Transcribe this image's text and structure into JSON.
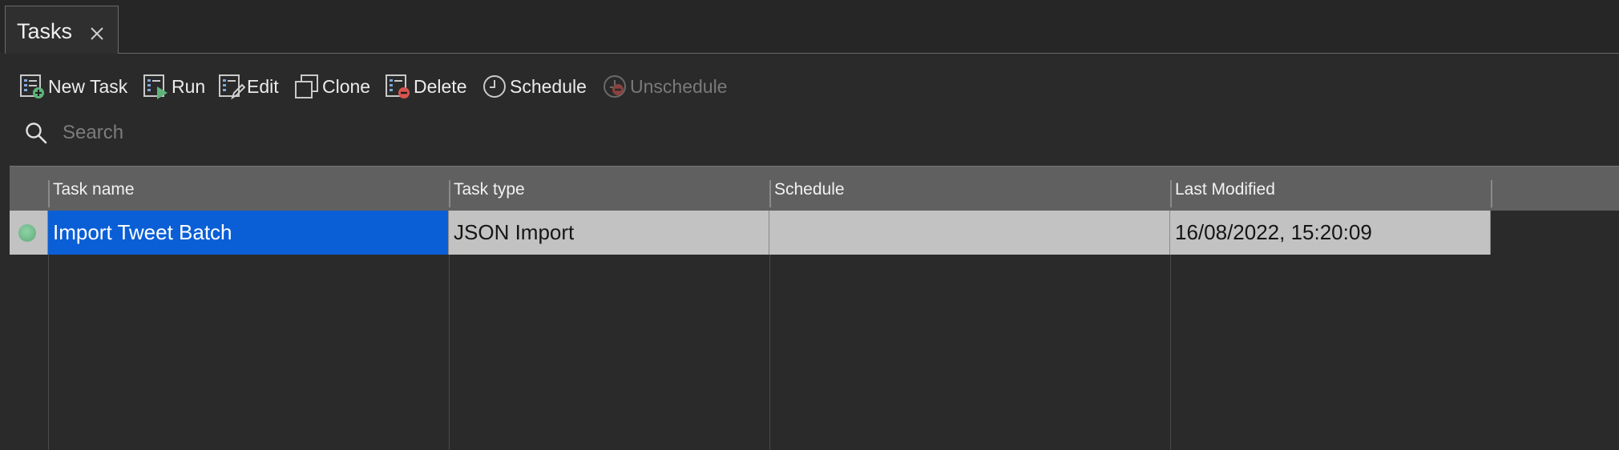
{
  "tab": {
    "title": "Tasks"
  },
  "toolbar": {
    "new_task": "New Task",
    "run": "Run",
    "edit": "Edit",
    "clone": "Clone",
    "delete": "Delete",
    "schedule": "Schedule",
    "unschedule": "Unschedule"
  },
  "search": {
    "placeholder": "Search",
    "value": ""
  },
  "table": {
    "columns": [
      "Task name",
      "Task type",
      "Schedule",
      "Last Modified"
    ],
    "rows": [
      {
        "status": "active",
        "task_name": "Import Tweet Batch",
        "task_type": "JSON Import",
        "schedule": "",
        "last_modified": "16/08/2022, 15:20:09"
      }
    ]
  },
  "colors": {
    "selection": "#0a5fd6",
    "status_active": "#6fbf8c",
    "delete_red": "#d9534f"
  },
  "icons": {
    "tab_close": "close-icon",
    "new_task": "task-add-icon",
    "run": "task-run-icon",
    "edit": "task-edit-icon",
    "clone": "clone-icon",
    "delete": "task-delete-icon",
    "schedule": "clock-icon",
    "unschedule": "clock-remove-icon",
    "search": "search-icon"
  }
}
